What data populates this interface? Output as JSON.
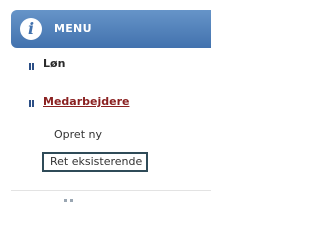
{
  "menu": {
    "title": "MENU",
    "icon": "info-icon"
  },
  "nav": {
    "items": [
      {
        "label": "Løn"
      },
      {
        "label": "Medarbejdere",
        "active": true
      }
    ]
  },
  "submenu": {
    "items": [
      {
        "label": "Opret ny"
      },
      {
        "label": "Ret eksisterende",
        "selected": true
      }
    ]
  },
  "colors": {
    "header": "#4f80bb",
    "active_link": "#8a2020",
    "bullet": "#2c4f86",
    "selection_border": "#2f4b58"
  }
}
